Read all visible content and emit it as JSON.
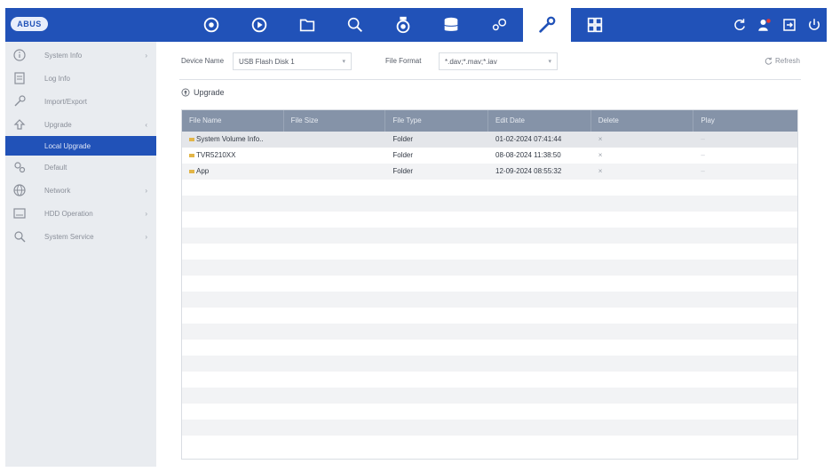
{
  "brand": {
    "logo_text": "ABUS"
  },
  "topbar": {
    "icons": [
      "camera-icon",
      "play-icon",
      "folder-icon",
      "search-icon",
      "ptz-camera-icon",
      "storage-icon",
      "settings-icon",
      "maintenance-icon",
      "grid-icon"
    ],
    "active_icon": "maintenance-icon",
    "right_icons": [
      "refresh-icon",
      "user-icon",
      "logout-icon",
      "power-icon"
    ]
  },
  "sidebar": {
    "items": [
      {
        "label": "System Info",
        "icon": "info-icon",
        "arrow": "›"
      },
      {
        "label": "Log Info",
        "icon": "log-icon",
        "arrow": ""
      },
      {
        "label": "Import/Export",
        "icon": "wrench-icon",
        "arrow": ""
      },
      {
        "label": "Upgrade",
        "icon": "upgrade-icon",
        "arrow": "‹"
      },
      {
        "label": "Local Upgrade",
        "icon": "",
        "arrow": ""
      },
      {
        "label": "Default",
        "icon": "default-icon",
        "arrow": ""
      },
      {
        "label": "Network",
        "icon": "network-icon",
        "arrow": "›"
      },
      {
        "label": "HDD Operation",
        "icon": "hdd-icon",
        "arrow": "›"
      },
      {
        "label": "System Service",
        "icon": "service-icon",
        "arrow": "›"
      }
    ]
  },
  "filters": {
    "device_name_label": "Device Name",
    "device_name_value": "USB Flash Disk 1",
    "file_format_label": "File Format",
    "file_format_value": "*.dav;*.mav;*.iav",
    "refresh_label": "Refresh"
  },
  "upgrade_button": "Upgrade",
  "table": {
    "columns": [
      "File Name",
      "File Size",
      "File Type",
      "Edit Date",
      "Delete",
      "Play"
    ],
    "rows": [
      {
        "name": "System Volume Info..",
        "size": "",
        "type": "Folder",
        "date": "01-02-2024 07:41:44",
        "delete": "×",
        "play": "–"
      },
      {
        "name": "TVR5210XX",
        "size": "",
        "type": "Folder",
        "date": "08-08-2024 11:38:50",
        "delete": "×",
        "play": "–"
      },
      {
        "name": "App",
        "size": "",
        "type": "Folder",
        "date": "12-09-2024 08:55:32",
        "delete": "×",
        "play": "–"
      }
    ],
    "empty_rows": 17
  }
}
